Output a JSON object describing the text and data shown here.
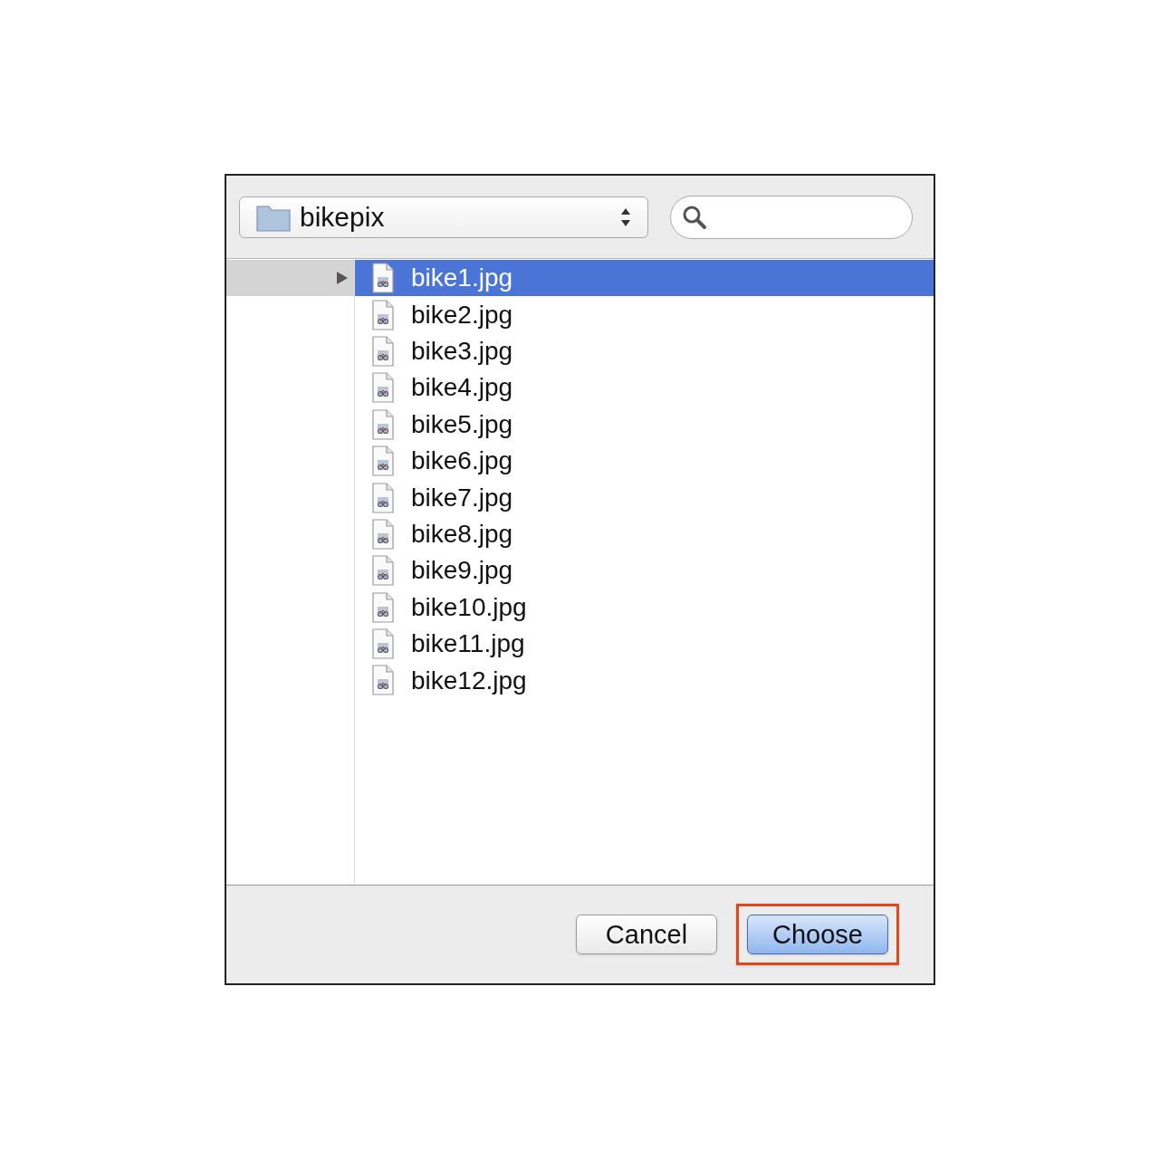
{
  "folder_popup": {
    "label": "bikepix"
  },
  "parent_column": {
    "selected": true
  },
  "files": [
    {
      "name": "bike1.jpg",
      "selected": true
    },
    {
      "name": "bike2.jpg",
      "selected": false
    },
    {
      "name": "bike3.jpg",
      "selected": false
    },
    {
      "name": "bike4.jpg",
      "selected": false
    },
    {
      "name": "bike5.jpg",
      "selected": false
    },
    {
      "name": "bike6.jpg",
      "selected": false
    },
    {
      "name": "bike7.jpg",
      "selected": false
    },
    {
      "name": "bike8.jpg",
      "selected": false
    },
    {
      "name": "bike9.jpg",
      "selected": false
    },
    {
      "name": "bike10.jpg",
      "selected": false
    },
    {
      "name": "bike11.jpg",
      "selected": false
    },
    {
      "name": "bike12.jpg",
      "selected": false
    }
  ],
  "buttons": [
    {
      "label": "Cancel",
      "kind": "normal",
      "highlighted": false
    },
    {
      "label": "Choose",
      "kind": "default",
      "highlighted": true
    }
  ]
}
